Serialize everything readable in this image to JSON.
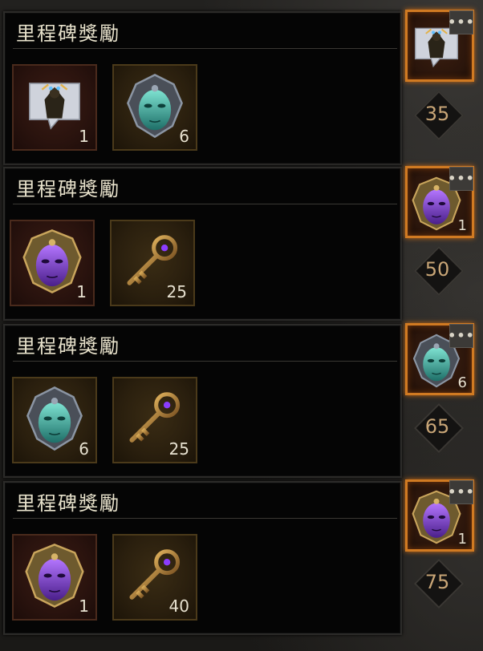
{
  "panels": [
    {
      "title": "里程碑獎勵",
      "rewards": [
        {
          "icon": "cloaked-figure-emote-icon",
          "count": "1"
        },
        {
          "icon": "teal-mask-icon",
          "count": "6"
        }
      ]
    },
    {
      "title": "里程碑獎勵",
      "rewards": [
        {
          "icon": "purple-mask-icon",
          "count": "1"
        },
        {
          "icon": "golden-key-icon",
          "count": "25"
        }
      ]
    },
    {
      "title": "里程碑獎勵",
      "rewards": [
        {
          "icon": "teal-mask-icon",
          "count": "6"
        },
        {
          "icon": "golden-key-icon",
          "count": "25"
        }
      ]
    },
    {
      "title": "里程碑獎勵",
      "rewards": [
        {
          "icon": "purple-mask-icon",
          "count": "1"
        },
        {
          "icon": "golden-key-icon",
          "count": "40"
        }
      ]
    }
  ],
  "track": [
    {
      "icon": "cloaked-figure-emote-icon",
      "count": "",
      "milestone": "35"
    },
    {
      "icon": "purple-mask-icon",
      "count": "1",
      "milestone": "50"
    },
    {
      "icon": "teal-mask-icon",
      "count": "6",
      "milestone": "65"
    },
    {
      "icon": "purple-mask-icon",
      "count": "1",
      "milestone": "75"
    }
  ],
  "more_label": "•••",
  "colors": {
    "highlight_border": "#d07a22",
    "title_text": "#e8e2cc",
    "milestone_text": "#c9a677"
  }
}
